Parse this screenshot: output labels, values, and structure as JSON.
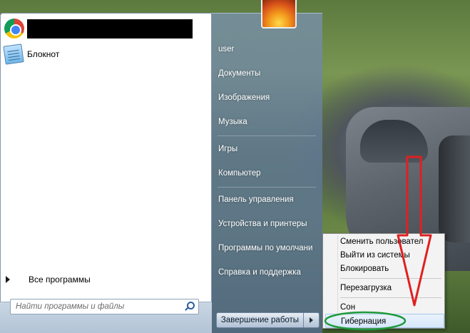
{
  "start_menu": {
    "pinned_programs": [
      {
        "icon": "chrome-icon",
        "label": ""
      },
      {
        "icon": "notepad-icon",
        "label": "Блокнот"
      }
    ],
    "all_programs_label": "Все программы",
    "search": {
      "placeholder": "Найти программы и файлы",
      "value": ""
    },
    "right_links": [
      "user",
      "Документы",
      "Изображения",
      "Музыка",
      "Игры",
      "Компьютер",
      "Панель управления",
      "Устройства и принтеры",
      "Программы по умолчани",
      "Справка и поддержка"
    ],
    "shutdown_label": "Завершение работы"
  },
  "power_menu": {
    "items": [
      "Сменить пользовател",
      "Выйти из системы",
      "Блокировать",
      "Перезагрузка",
      "Сон",
      "Гибернация"
    ],
    "highlighted": "Гибернация"
  },
  "colors": {
    "annotation_arrow": "#e02020",
    "annotation_ellipse": "#1f9a3a",
    "start_right_pane": "#6e8aa6"
  }
}
